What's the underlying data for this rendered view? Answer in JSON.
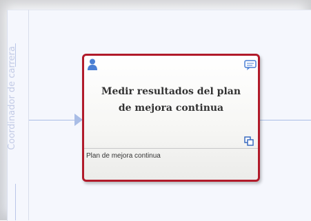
{
  "lane": {
    "label": "Coordinador de carrera"
  },
  "task": {
    "title_line1": "Medir resultados del plan",
    "title_line2": "de mejora continua",
    "footer": "Plan de mejora continua",
    "icons": [
      "user-icon",
      "comment-icon",
      "subprocess-icon"
    ]
  },
  "colors": {
    "task_border": "#b11a2a",
    "connector": "#a9bde6",
    "lane_text": "#c3cbe6",
    "icon_blue": "#4a7fd4"
  }
}
